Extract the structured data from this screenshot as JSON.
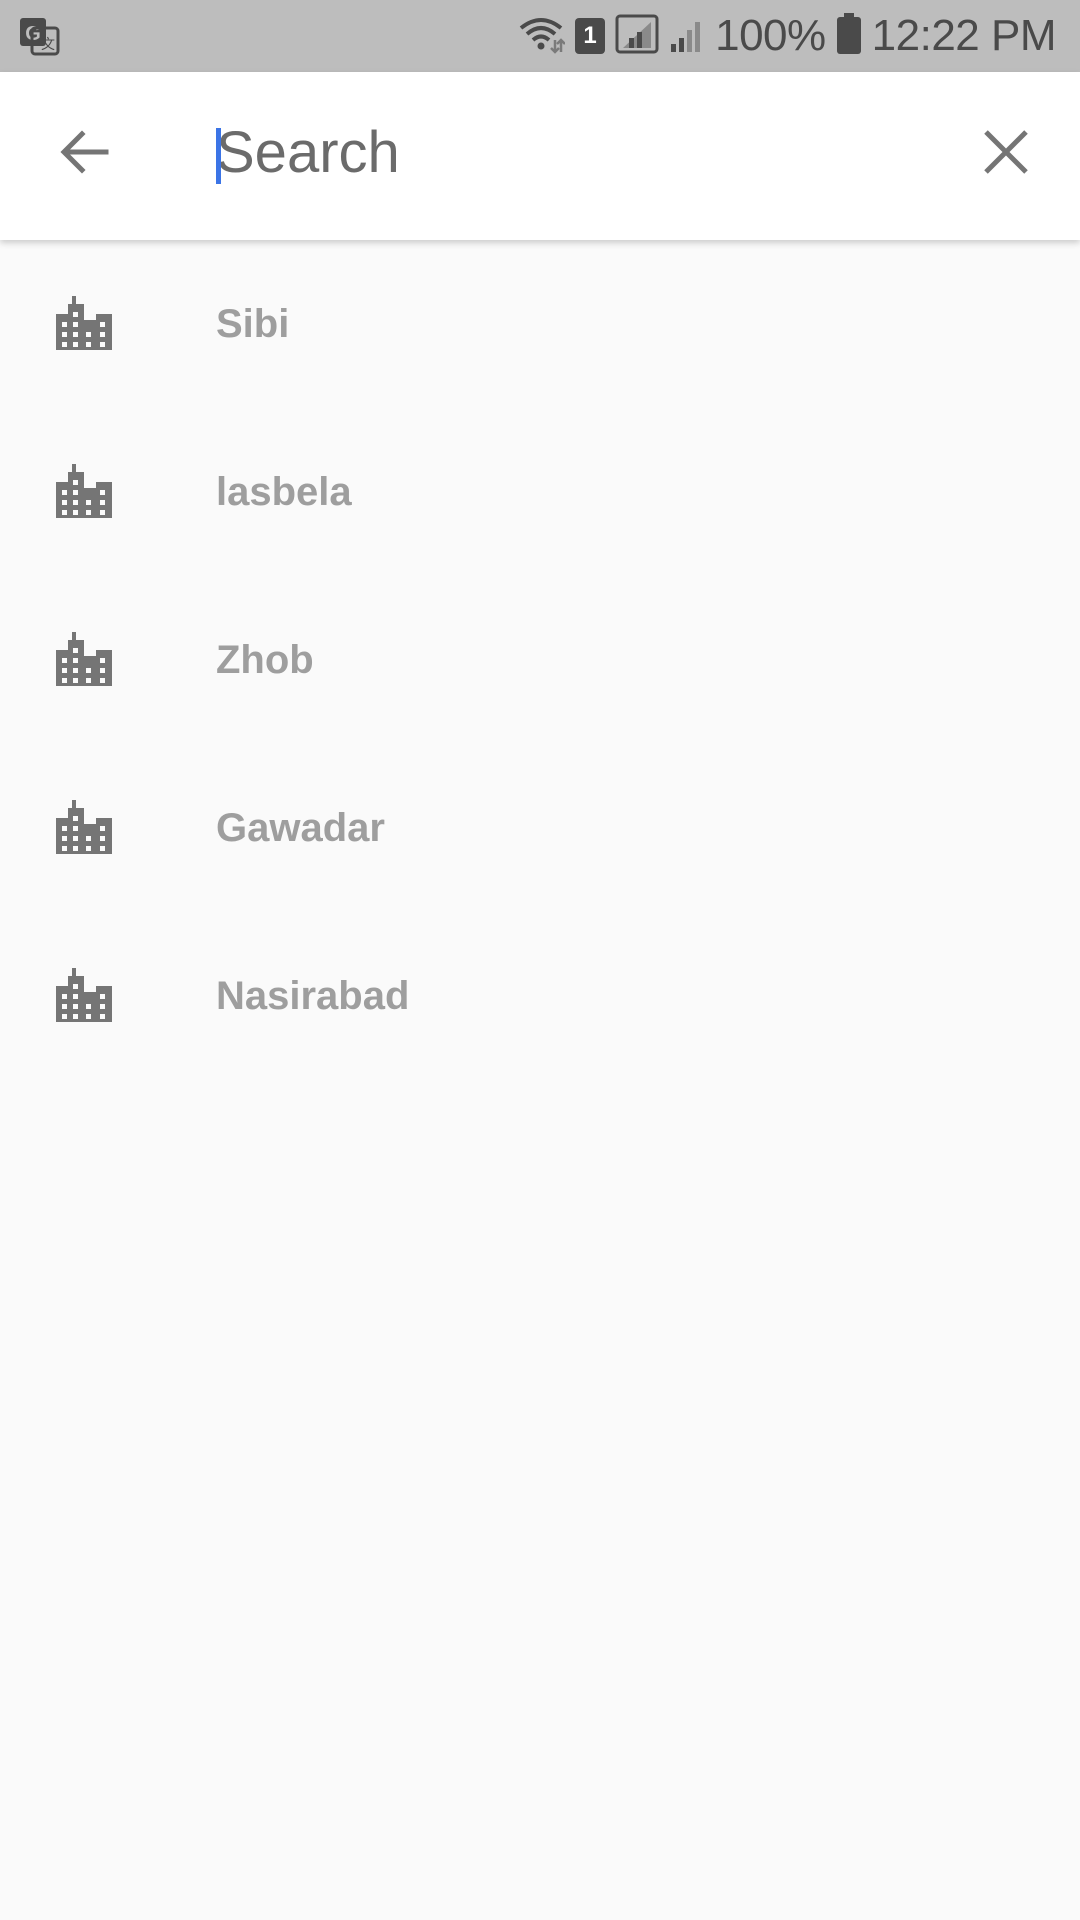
{
  "status_bar": {
    "left_icon": "google-translate-icon",
    "sim_number": "1",
    "battery_percent": "100%",
    "time": "12:22 PM"
  },
  "search": {
    "placeholder": "Search",
    "value": ""
  },
  "results": [
    {
      "label": "Sibi",
      "icon": "city-icon"
    },
    {
      "label": "lasbela",
      "icon": "city-icon"
    },
    {
      "label": "Zhob",
      "icon": "city-icon"
    },
    {
      "label": "Gawadar",
      "icon": "city-icon"
    },
    {
      "label": "Nasirabad",
      "icon": "city-icon"
    }
  ],
  "colors": {
    "status_bar": "#bdbdbd",
    "background": "#fafafa",
    "icon": "#757575",
    "label": "#9e9e9e",
    "caret": "#3b74e6"
  }
}
